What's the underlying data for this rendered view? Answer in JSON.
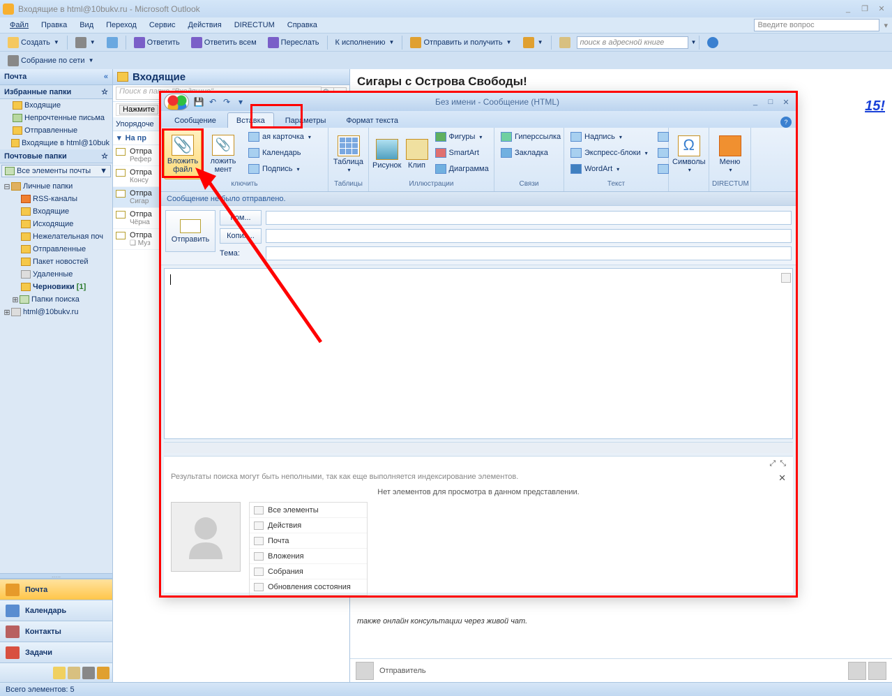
{
  "app": {
    "title": "Входящие в html@10bukv.ru - Microsoft Outlook",
    "question_placeholder": "Введите вопрос"
  },
  "menus": [
    "Файл",
    "Правка",
    "Вид",
    "Переход",
    "Сервис",
    "Действия",
    "DIRECTUM",
    "Справка"
  ],
  "toolbar1": {
    "new": "Создать",
    "reply": "Ответить",
    "reply_all": "Ответить всем",
    "forward": "Переслать",
    "follow_up": "К исполнению",
    "send_receive": "Отправить и получить",
    "address_search": "поиск в адресной книге"
  },
  "toolbar2": {
    "meeting": "Собрание по сети"
  },
  "nav": {
    "header": "Почта",
    "fav_header": "Избранные папки",
    "fav_items": [
      "Входящие",
      "Непрочтенные письма",
      "Отправленные",
      "Входящие в html@10buk"
    ],
    "mail_header": "Почтовые папки",
    "all_items": "Все элементы почты",
    "personal": "Личные папки",
    "tree": [
      "RSS-каналы",
      "Входящие",
      "Исходящие",
      "Нежелательная поч",
      "Отправленные",
      "Пакет новостей",
      "Удаленные"
    ],
    "drafts": "Черновики",
    "drafts_count": "[1]",
    "search_folders": "Папки поиска",
    "account": "html@10bukv.ru",
    "big_btns": [
      "Почта",
      "Календарь",
      "Контакты",
      "Задачи"
    ]
  },
  "msglist": {
    "folder": "Входящие",
    "search_ph": "Поиск в папке \"Входящие\"",
    "click_line": "Нажмите",
    "arrange": "Упорядоче",
    "group": "На пр",
    "items": [
      {
        "from": "Отпра",
        "subj": "Рефер"
      },
      {
        "from": "Отпра",
        "subj": "Консу"
      },
      {
        "from": "Отпра",
        "subj": "Сигар"
      },
      {
        "from": "Отпра",
        "subj": "Чёрна"
      },
      {
        "from": "Отпра",
        "subj": "❑ Муз"
      }
    ]
  },
  "reading": {
    "subject": "Сигары с Острова Свободы!",
    "year_link": "15!",
    "body_line": "также онлайн консультации через живой чат.",
    "sender": "Отправитель"
  },
  "statusbar": {
    "text": "Всего элементов: 5"
  },
  "compose": {
    "title": "Без имени - Сообщение (HTML)",
    "tabs": [
      "Сообщение",
      "Вставка",
      "Параметры",
      "Формат текста"
    ],
    "ribbon": {
      "attach_file": "Вложить файл",
      "attach_item": "ложить\nмент",
      "biz_card": "ая карточка",
      "calendar": "Календарь",
      "signature": "Подпись",
      "include": "ключить",
      "table": "Таблица",
      "tables": "Таблицы",
      "picture": "Рисунок",
      "clip": "Клип",
      "shapes": "Фигуры",
      "smartart": "SmartArt",
      "chart": "Диаграмма",
      "illustrations": "Иллюстрации",
      "hyperlink": "Гиперссылка",
      "bookmark": "Закладка",
      "links": "Связи",
      "textbox": "Надпись",
      "quick_parts": "Экспресс-блоки",
      "wordart": "WordArt",
      "text": "Текст",
      "symbols": "Символы",
      "menu": "Меню",
      "directum": "DIRECTUM"
    },
    "info_bar": "Сообщение не было отправлено.",
    "send": "Отправить",
    "to": "Ком...",
    "cc": "Копия...",
    "subject_label": "Тема:",
    "search_warning": "Результаты поиска могут быть неполными, так как еще выполняется индексирование элементов.",
    "no_items": "Нет элементов для просмотра в данном представлении.",
    "detail_items": [
      "Все элементы",
      "Действия",
      "Почта",
      "Вложения",
      "Собрания",
      "Обновления состояния"
    ]
  }
}
